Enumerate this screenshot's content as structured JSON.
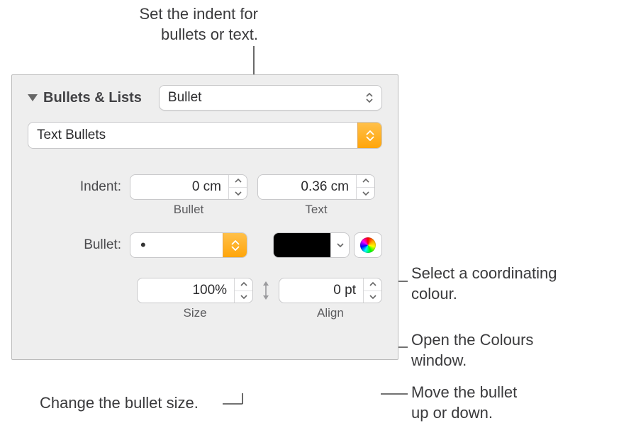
{
  "callouts": {
    "top": "Set the indent for\nbullets or text.",
    "swatch": "Select a coordinating\ncolour.",
    "wheel": "Open the Colours\nwindow.",
    "align": "Move the bullet\nup or down.",
    "size": "Change the bullet size."
  },
  "panel": {
    "section_title": "Bullets & Lists",
    "style_select": "Bullet",
    "type_select": "Text Bullets",
    "indent_label": "Indent:",
    "indent_bullet_value": "0 cm",
    "indent_bullet_sub": "Bullet",
    "indent_text_value": "0.36 cm",
    "indent_text_sub": "Text",
    "bullet_label": "Bullet:",
    "bullet_char": "•",
    "size_value": "100%",
    "size_sub": "Size",
    "align_value": "0 pt",
    "align_sub": "Align"
  }
}
